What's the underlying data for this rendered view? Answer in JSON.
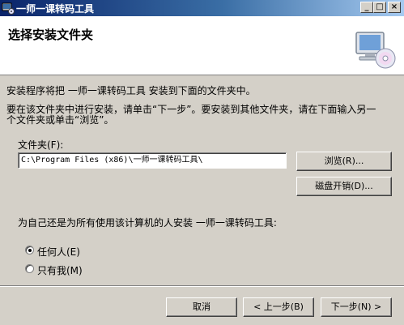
{
  "window": {
    "title": "一师一课转码工具",
    "minimize": "_",
    "maximize": "□",
    "close": "×"
  },
  "header": {
    "title": "选择安装文件夹",
    "icon": "computer-cd-icon"
  },
  "body": {
    "intro": "安装程序将把 一师一课转码工具 安装到下面的文件夹中。",
    "instruction_line1": "要在该文件夹中进行安装，请单击“下一步”。要安装到其他文件夹，请在下面输入另一",
    "instruction_line2": "个文件夹或单击“浏览”。",
    "folder_label": "文件夹(F):",
    "folder_value": "C:\\Program Files (x86)\\一师一课转码工具\\",
    "browse_label": "浏览(R)...",
    "disk_cost_label": "磁盘开销(D)...",
    "install_for_question": "为自己还是为所有使用该计算机的人安装 一师一课转码工具:",
    "radio_everyone": "任何人(E)",
    "radio_just_me": "只有我(M)",
    "selected": "everyone"
  },
  "footer": {
    "cancel_label": "取消",
    "back_label": "< 上一步(B)",
    "next_label": "下一步(N) >"
  }
}
